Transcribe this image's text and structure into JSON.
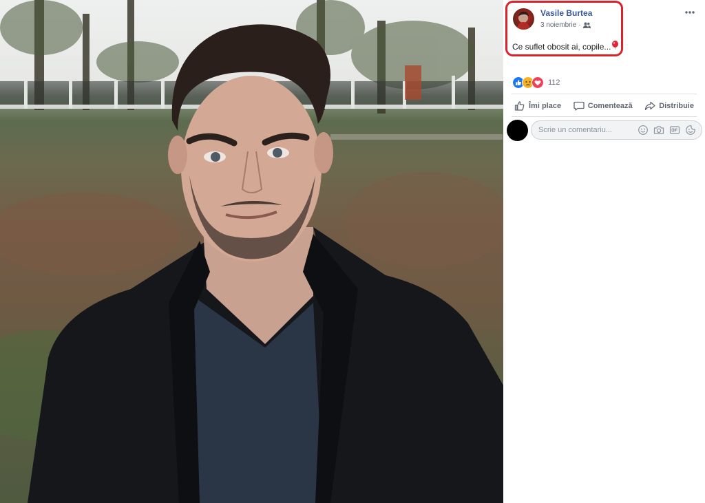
{
  "post": {
    "author": "Vasile Burtea",
    "date": "3 noiembrie",
    "separator": "·",
    "audience_icon": "friends-icon",
    "text": "Ce suflet obosit ai, copile...",
    "text_emoji": "balloon-icon"
  },
  "reactions": {
    "icons": [
      "like-reaction-icon",
      "sad-reaction-icon",
      "love-reaction-icon"
    ],
    "count": "112"
  },
  "actions": {
    "like_label": "Îmi place",
    "comment_label": "Comentează",
    "share_label": "Distribuie"
  },
  "comment": {
    "placeholder": "Scrie un comentariu...",
    "tools": [
      "emoji-icon",
      "camera-icon",
      "gif-icon",
      "sticker-icon"
    ]
  },
  "colors": {
    "author_link": "#385898",
    "highlight_border": "#d8232a",
    "like_blue": "#1877f2",
    "love_red": "#f33e58",
    "sad_yellow": "#f7b125",
    "action_gray": "#606770"
  }
}
